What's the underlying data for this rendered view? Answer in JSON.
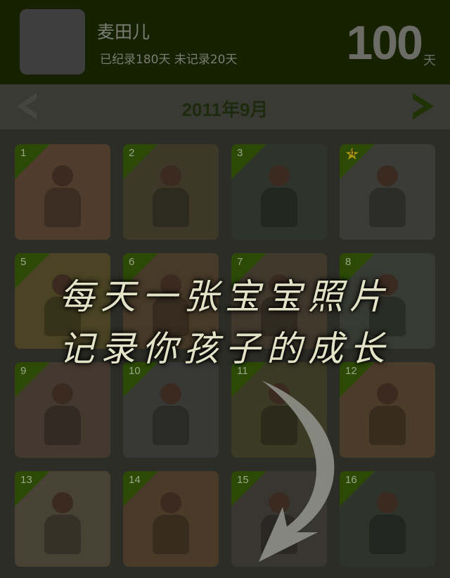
{
  "header": {
    "name": "麦田儿",
    "stats": "已纪录180天 未记录20天",
    "days_count": "100",
    "days_unit": "天"
  },
  "calendar": {
    "month_label": "2011年9月",
    "photos": [
      {
        "num": "1",
        "bg": "#4f3c2d",
        "starred": false
      },
      {
        "num": "2",
        "bg": "#3d3828",
        "starred": false
      },
      {
        "num": "3",
        "bg": "#2e342b",
        "starred": false
      },
      {
        "num": "4",
        "bg": "#3b3c38",
        "starred": true
      },
      {
        "num": "5",
        "bg": "#4a4424",
        "starred": false
      },
      {
        "num": "6",
        "bg": "#473a29",
        "starred": false
      },
      {
        "num": "7",
        "bg": "#41392c",
        "starred": false
      },
      {
        "num": "8",
        "bg": "#383b33",
        "starred": false
      },
      {
        "num": "9",
        "bg": "#44392f",
        "starred": false
      },
      {
        "num": "10",
        "bg": "#383937",
        "starred": false
      },
      {
        "num": "11",
        "bg": "#3a3a25",
        "starred": false
      },
      {
        "num": "12",
        "bg": "#4b3b29",
        "starred": false
      },
      {
        "num": "13",
        "bg": "#474233",
        "starred": false
      },
      {
        "num": "14",
        "bg": "#4a3b28",
        "starred": false
      },
      {
        "num": "15",
        "bg": "#383630",
        "starred": false
      },
      {
        "num": "16",
        "bg": "#2e332c",
        "starred": false
      }
    ]
  },
  "overlay": {
    "line1": "每天一张宝宝照片",
    "line2": "记录你孩子的成长"
  },
  "colors": {
    "header_bg": "#152100",
    "accent_green": "#2c4a06",
    "star_gold": "#b09a0e"
  },
  "icons": {
    "prev": "chevron-left-icon",
    "next": "chevron-right-icon",
    "star": "star-icon",
    "hint_arrow": "curved-arrow-icon"
  }
}
